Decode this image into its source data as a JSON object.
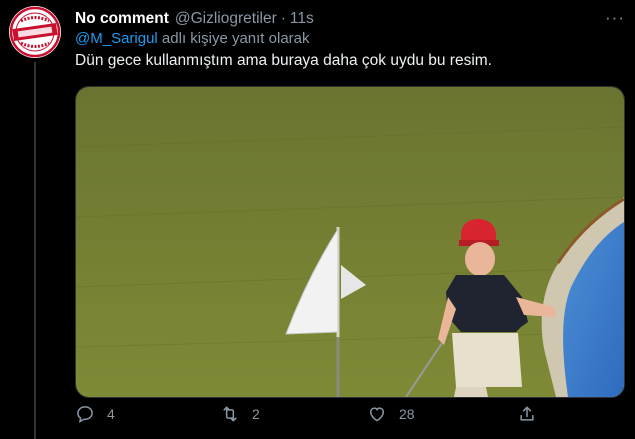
{
  "tweet": {
    "display_name": "No comment",
    "handle": "@Gizliogretiler",
    "separator": "·",
    "time": "11s",
    "reply_to_handle": "@M_Sarigul",
    "reply_suffix": " adlı kişiye yanıt olarak",
    "text": "Dün gece kullanmıştım ama buraya daha çok uydu bu resim.",
    "more_label": "···"
  },
  "avatar": {
    "top_text": "NO COMMENT",
    "middle_text": "NO COMMENT",
    "bottom_text": "NO COMMENT",
    "color": "#c8102e"
  },
  "media": {
    "description_icon": "golf-photo",
    "hat_color": "#d8242e",
    "vest_color": "#1f2430",
    "grass_color": "#6f7a2e",
    "water_color": "#3a78c9"
  },
  "actions": {
    "reply_count": "4",
    "retweet_count": "2",
    "like_count": "28"
  },
  "colors": {
    "background": "#000000",
    "muted": "#8b98a5",
    "link": "#1d9bf0"
  }
}
